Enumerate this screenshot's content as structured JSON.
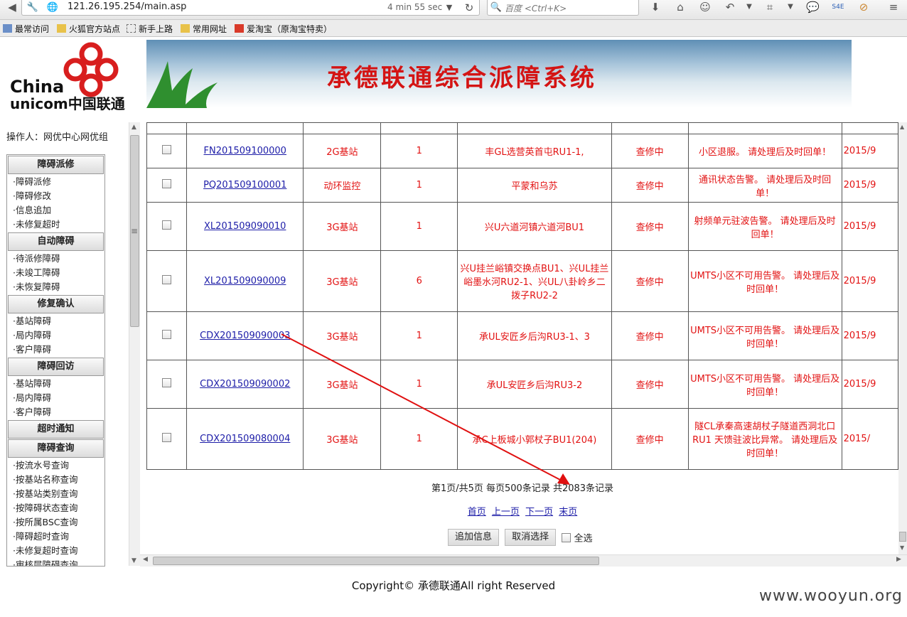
{
  "browser": {
    "url": "121.26.195.254/main.asp",
    "load_time": "4 min 55 sec",
    "search_placeholder": "百度 <Ctrl+K>",
    "bookmarks": [
      "最常访问",
      "火狐官方站点",
      "新手上路",
      "常用网址",
      "爱淘宝（原淘宝特卖）"
    ]
  },
  "header": {
    "logo_line1": "China",
    "logo_line2": "unicom中国联通",
    "title": "承德联通综合派障系统"
  },
  "sidebar": {
    "operator": "操作人：网优中心网优组",
    "sections": [
      {
        "title": "障碍派修",
        "items": [
          "·障碍派修",
          "·障碍修改",
          "·信息追加",
          "·未修复超时"
        ]
      },
      {
        "title": "自动障碍",
        "items": [
          "·待派修障碍",
          "·未竣工障碍",
          "·未恢复障碍"
        ]
      },
      {
        "title": "修复确认",
        "items": [
          "·基站障碍",
          "·局内障碍",
          "·客户障碍"
        ]
      },
      {
        "title": "障碍回访",
        "items": [
          "·基站障碍",
          "·局内障碍",
          "·客户障碍"
        ]
      },
      {
        "title": "超时通知",
        "items": []
      },
      {
        "title": "障碍查询",
        "items": [
          "·按流水号查询",
          "·按基站名称查询",
          "·按基站类别查询",
          "·按障碍状态查询",
          "·按所属BSC查询",
          "·障碍超时查询",
          "·未修复超时查询",
          "·审核层障碍查询"
        ]
      }
    ]
  },
  "table": {
    "rows": [
      {
        "id": "FN201509100000",
        "type": "2G基站",
        "count": "1",
        "site": "丰GL选营英首屯RU1-1,",
        "status": "查修中",
        "desc": "小区退服。 请处理后及时回单！",
        "date": "2015/9"
      },
      {
        "id": "PQ201509100001",
        "type": "动环监控",
        "count": "1",
        "site": "平蒙和乌苏",
        "status": "查修中",
        "desc": "通讯状态告警。 请处理后及时回单！",
        "date": "2015/9"
      },
      {
        "id": "XL201509090010",
        "type": "3G基站",
        "count": "1",
        "site": "兴U六道河镇六道河BU1",
        "status": "查修中",
        "desc": "射频单元驻波告警。 请处理后及时回单！",
        "date": "2015/9"
      },
      {
        "id": "XL201509090009",
        "type": "3G基站",
        "count": "6",
        "site": "兴U挂兰峪镇交换点BU1、兴UL挂兰峪墨水河RU2-1、兴UL八卦岭乡二拨子RU2-2",
        "status": "查修中",
        "desc": "UMTS小区不可用告警。 请处理后及时回单！",
        "date": "2015/9"
      },
      {
        "id": "CDX201509090003",
        "type": "3G基站",
        "count": "1",
        "site": "承UL安匠乡后沟RU3-1、3",
        "status": "查修中",
        "desc": "UMTS小区不可用告警。 请处理后及时回单！",
        "date": "2015/9"
      },
      {
        "id": "CDX201509090002",
        "type": "3G基站",
        "count": "1",
        "site": "承UL安匠乡后沟RU3-2",
        "status": "查修中",
        "desc": "UMTS小区不可用告警。 请处理后及时回单！",
        "date": "2015/9"
      },
      {
        "id": "CDX201509080004",
        "type": "3G基站",
        "count": "1",
        "site": "承C上板城小郭杖子BU1(204)",
        "status": "查修中",
        "desc": "隧CL承秦高速胡杖子隧道西洞北口RU1 天馈驻波比异常。 请处理后及时回单！",
        "date": "2015/"
      }
    ]
  },
  "pager": {
    "info": "第1页/共5页 每页500条记录 共2083条记录",
    "first": "首页",
    "prev": "上一页",
    "next": "下一页",
    "last": "末页"
  },
  "actions": {
    "add_info": "追加信息",
    "cancel_select": "取消选择",
    "select_all": "全选"
  },
  "footer": {
    "copyright": "Copyright© 承德联通All right Reserved",
    "watermark": "www.wooyun.org"
  },
  "colors": {
    "accent_red": "#e21212",
    "link_blue": "#1d1da8",
    "annotation_red": "#e01010"
  }
}
